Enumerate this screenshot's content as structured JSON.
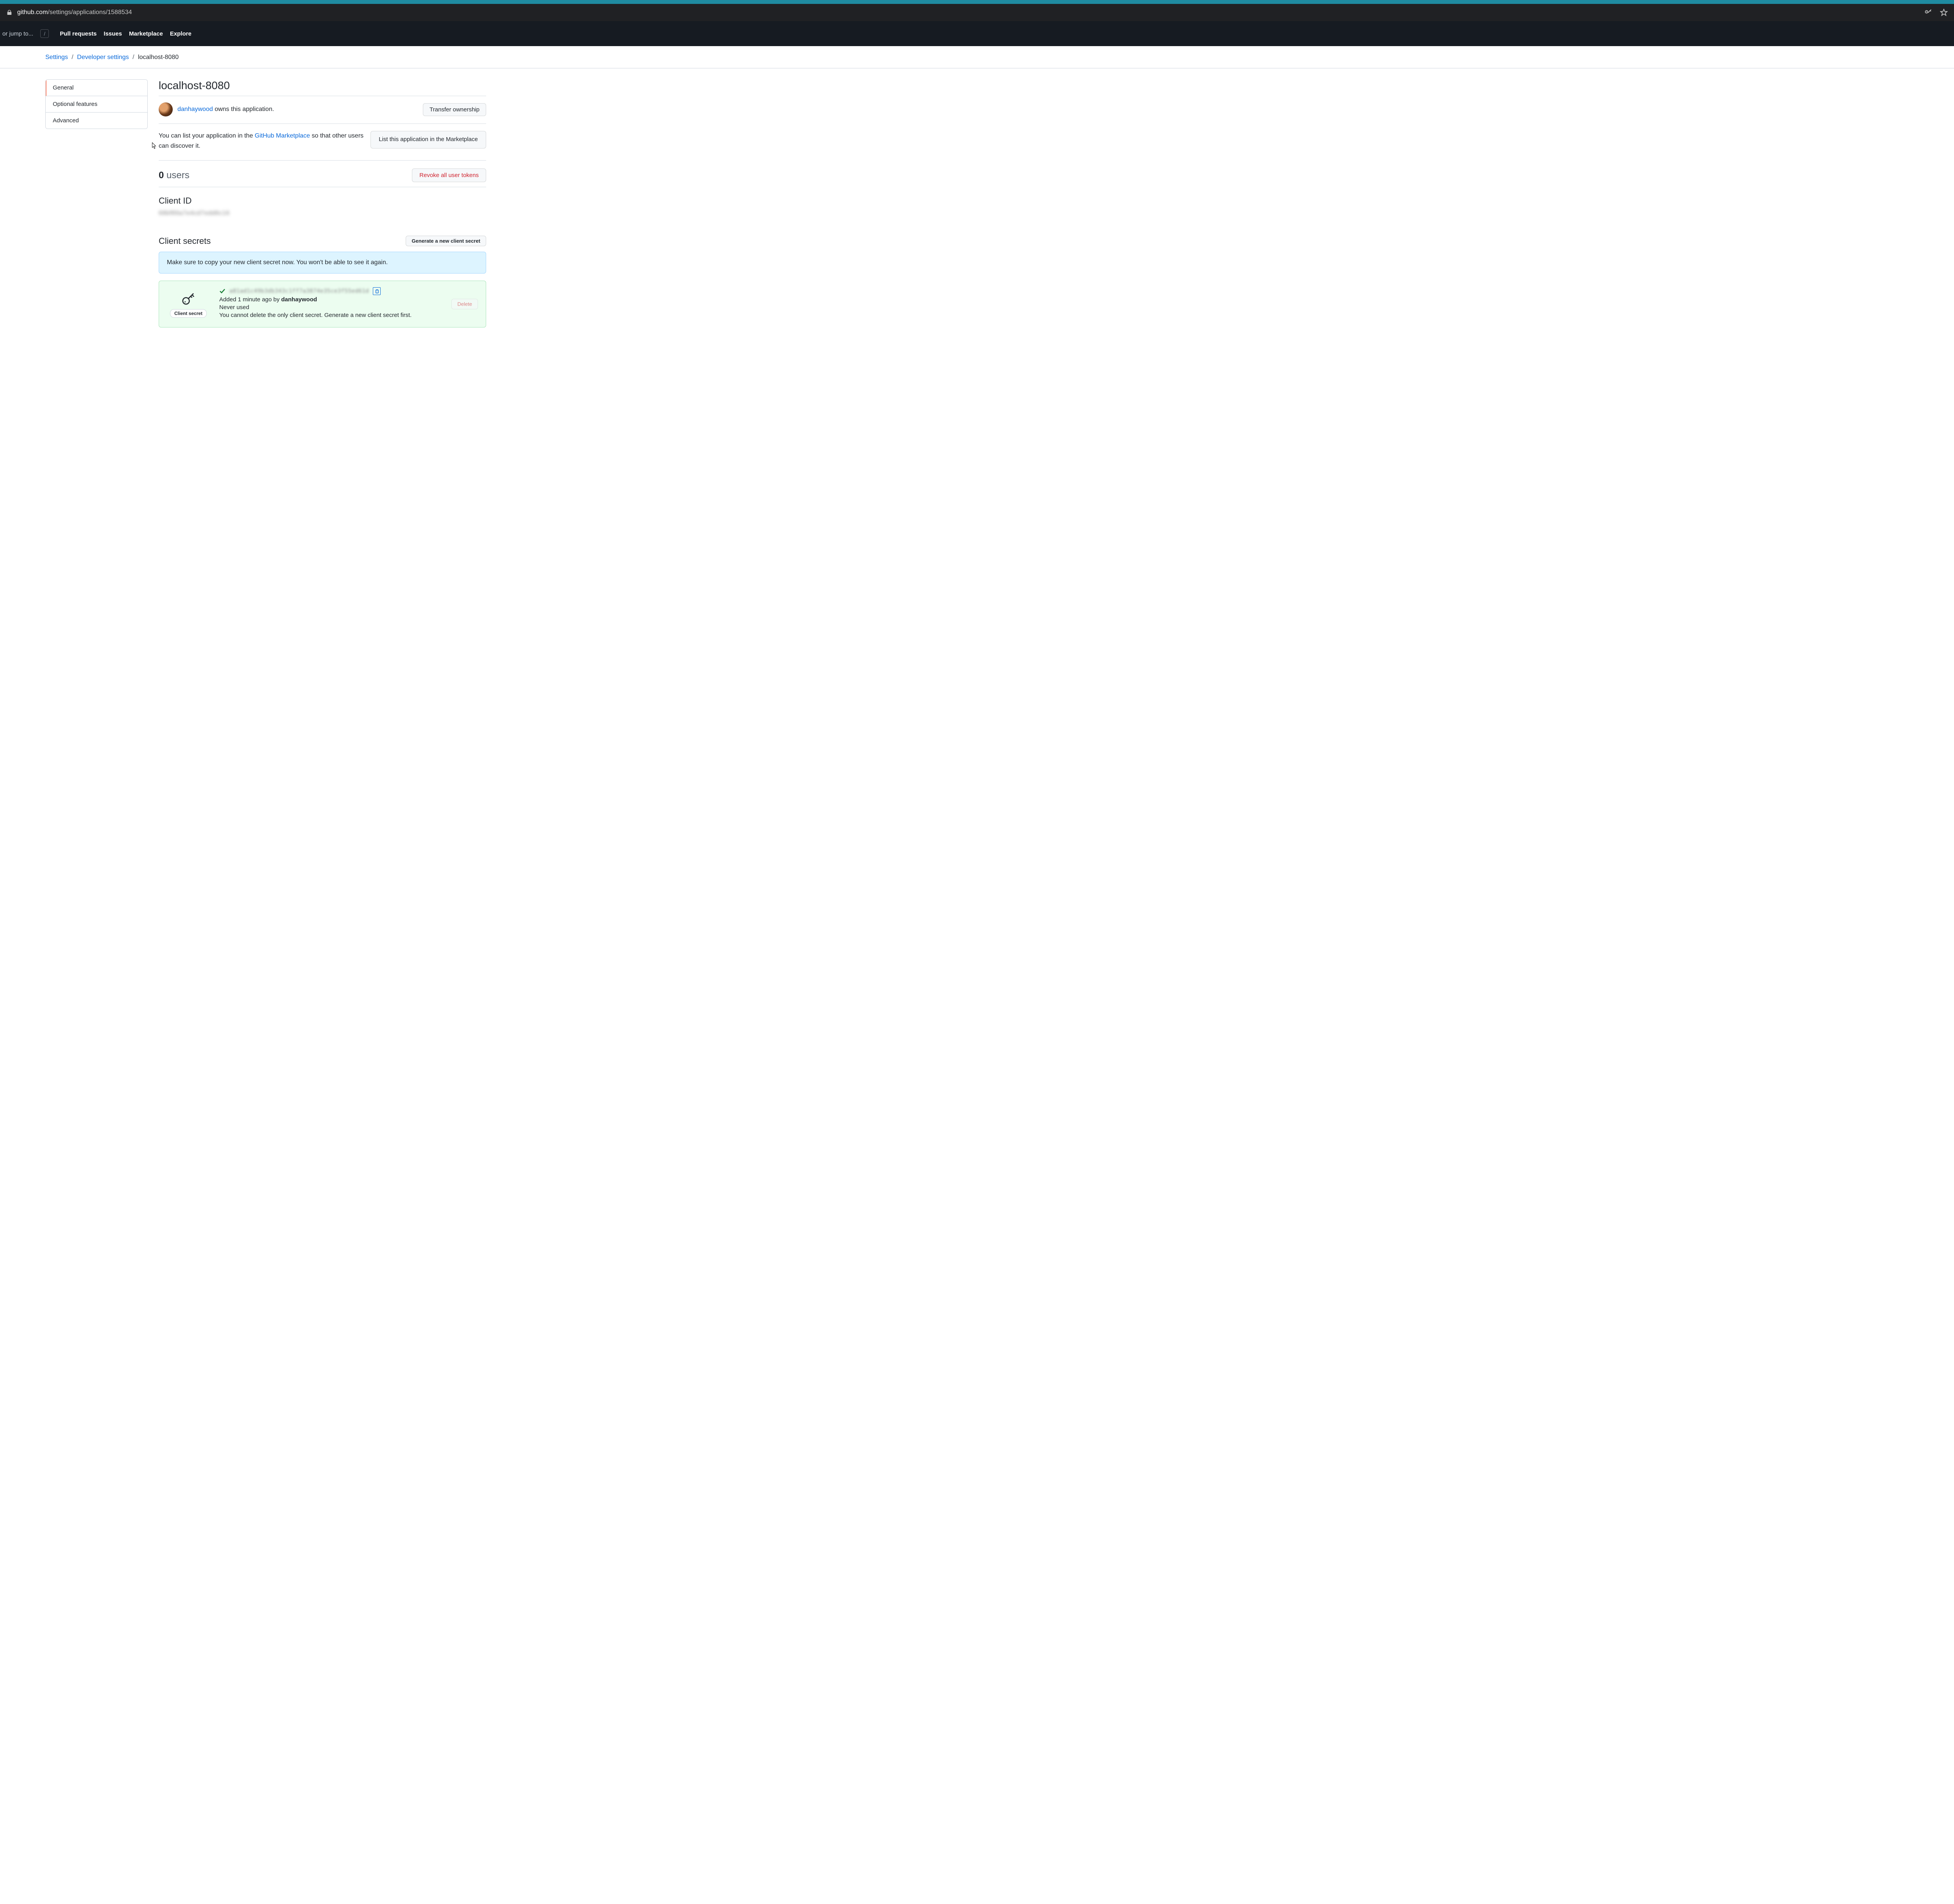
{
  "tab_bar": {
    "color": "#1f8ba1"
  },
  "url_bar": {
    "domain": "github.com",
    "path": "/settings/applications/1588534"
  },
  "header": {
    "search_placeholder": "or jump to...",
    "slash_key": "/",
    "nav": [
      "Pull requests",
      "Issues",
      "Marketplace",
      "Explore"
    ]
  },
  "breadcrumb": {
    "items": [
      {
        "label": "Settings",
        "link": true
      },
      {
        "label": "Developer settings",
        "link": true
      },
      {
        "label": "localhost-8080",
        "link": false
      }
    ],
    "separator": "/"
  },
  "sidebar": {
    "items": [
      {
        "label": "General",
        "active": true
      },
      {
        "label": "Optional features",
        "active": false
      },
      {
        "label": "Advanced",
        "active": false
      }
    ]
  },
  "main": {
    "title": "localhost-8080",
    "owner": {
      "username": "danhaywood",
      "suffix": " owns this application."
    },
    "transfer_button": "Transfer ownership",
    "marketplace": {
      "text_prefix": "You can list your application in the ",
      "link_text": "GitHub Marketplace",
      "text_suffix": " so that other users can discover it.",
      "button": "List this application in the Marketplace"
    },
    "users": {
      "count": "0",
      "label": " users",
      "revoke_button": "Revoke all user tokens"
    },
    "client_id": {
      "heading": "Client ID",
      "value": "68bf89a7e4cd7edd6c16"
    },
    "secrets": {
      "heading": "Client secrets",
      "generate_button": "Generate a new client secret",
      "notice": "Make sure to copy your new client secret now. You won't be able to see it again.",
      "item": {
        "label": "Client secret",
        "value": "a81ad1c49b3db343c1ff7a3874e35ce3f55ed61d",
        "added_prefix": "Added ",
        "added_time": "1 minute ago",
        "added_by_prefix": " by ",
        "added_by": "danhaywood",
        "usage": "Never used",
        "delete_note": "You cannot delete the only client secret. Generate a new client secret first.",
        "delete_button": "Delete"
      }
    }
  }
}
